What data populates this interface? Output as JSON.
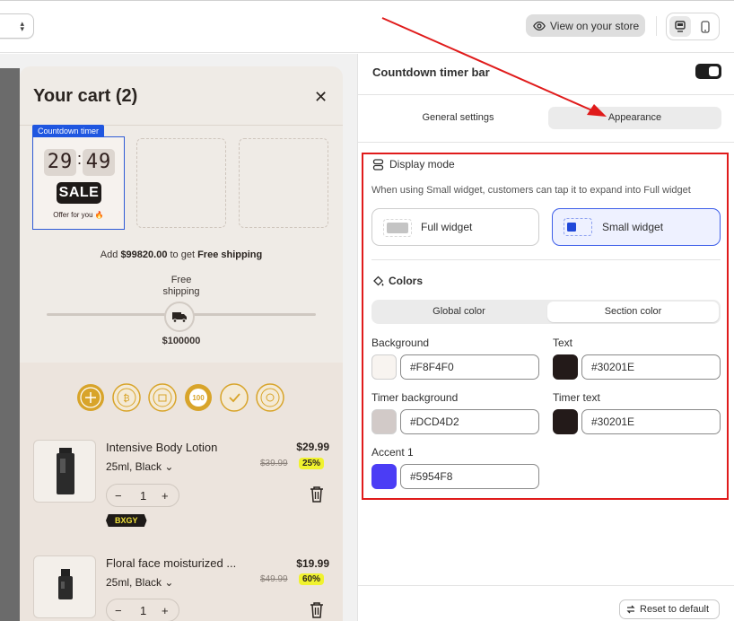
{
  "topbar": {
    "view_store_label": "View on your store"
  },
  "cart": {
    "title": "Your cart (2)",
    "close_glyph": "✕",
    "countdown": {
      "tag": "Countdown timer",
      "minutes": "29",
      "seconds": "49",
      "colon": ":",
      "sale_label": "SALE",
      "offer_text": "Offer for you 🔥"
    },
    "shipping": {
      "prefix": "Add ",
      "amount": "$99820.00",
      "middle": " to get ",
      "goal": "Free shipping",
      "free_label": "Free shipping",
      "target": "$100000",
      "progress_fraction": 0.0018
    },
    "items": [
      {
        "name": "Intensive Body Lotion",
        "variant": "25ml, Black",
        "price": "$29.99",
        "old_price": "$39.99",
        "discount": "25%",
        "qty": "1",
        "tag": "BXGY"
      },
      {
        "name": "Floral face moisturized ...",
        "variant": "25ml, Black",
        "price": "$19.99",
        "old_price": "$49.99",
        "discount": "60%",
        "qty": "1"
      }
    ],
    "stepper": {
      "minus": "−",
      "plus": "+"
    }
  },
  "panel": {
    "title": "Countdown timer bar",
    "tabs": {
      "general": "General settings",
      "appearance": "Appearance"
    },
    "display_mode": {
      "title": "Display mode",
      "description": "When using Small widget, customers can tap it to expand into Full widget",
      "options": {
        "full": "Full widget",
        "small": "Small widget"
      },
      "selected": "small"
    },
    "colors": {
      "title": "Colors",
      "segments": {
        "global": "Global color",
        "section": "Section color"
      },
      "selected_segment": "section",
      "fields": {
        "background": {
          "label": "Background",
          "value": "#F8F4F0"
        },
        "text": {
          "label": "Text",
          "value": "#30201E"
        },
        "timer_background": {
          "label": "Timer background",
          "value": "#DCD4D2"
        },
        "timer_text": {
          "label": "Timer text",
          "value": "#30201E"
        },
        "accent1": {
          "label": "Accent 1",
          "value": "#5954F8"
        }
      }
    },
    "reset_label": "Reset to default"
  },
  "colors": {
    "annotation_red": "#e01b1b",
    "accent_blue": "#3d5ee8"
  }
}
